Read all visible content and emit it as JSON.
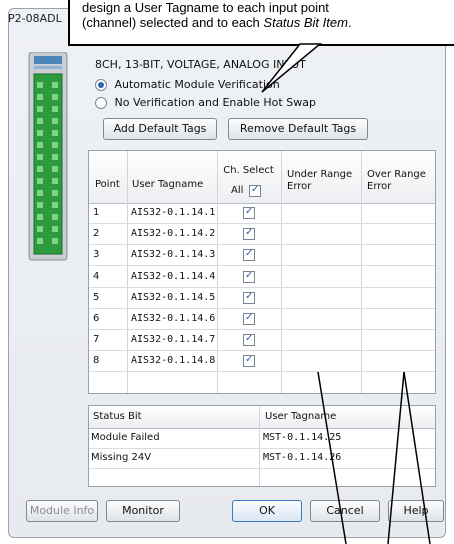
{
  "window": {
    "title": "P2-08ADL"
  },
  "callout": {
    "line1": "design a User Tagname to each input point",
    "line2_prefix": "(channel) selected and to each ",
    "line2_em": "Status Bit Item",
    "line2_suffix": "."
  },
  "module": {
    "description": "8CH, 13-BIT, VOLTAGE, ANALOG INPUT"
  },
  "options": {
    "auto_verify": "Automatic Module Verification",
    "no_verify": "No Verification and Enable Hot Swap",
    "selected": "auto_verify"
  },
  "buttons": {
    "add_default_tags": "Add Default Tags",
    "remove_default_tags": "Remove Default Tags",
    "module_info": "Module Info",
    "monitor": "Monitor",
    "ok": "OK",
    "cancel": "Cancel",
    "help": "Help"
  },
  "grid": {
    "headers": {
      "point": "Point",
      "user_tagname": "User Tagname",
      "ch_select": "Ch. Select",
      "all": "All",
      "under_range": "Under Range Error",
      "over_range": "Over Range Error"
    },
    "rows": [
      {
        "point": "1",
        "tag": "AIS32-0.1.14.1",
        "checked": true
      },
      {
        "point": "2",
        "tag": "AIS32-0.1.14.2",
        "checked": true
      },
      {
        "point": "3",
        "tag": "AIS32-0.1.14.3",
        "checked": true
      },
      {
        "point": "4",
        "tag": "AIS32-0.1.14.4",
        "checked": true
      },
      {
        "point": "5",
        "tag": "AIS32-0.1.14.5",
        "checked": true
      },
      {
        "point": "6",
        "tag": "AIS32-0.1.14.6",
        "checked": true
      },
      {
        "point": "7",
        "tag": "AIS32-0.1.14.7",
        "checked": true
      },
      {
        "point": "8",
        "tag": "AIS32-0.1.14.8",
        "checked": true
      }
    ]
  },
  "status": {
    "headers": {
      "status_bit": "Status Bit",
      "user_tagname": "User Tagname"
    },
    "rows": [
      {
        "bit": "Module Failed",
        "tag": "MST-0.1.14.25"
      },
      {
        "bit": "Missing 24V",
        "tag": "MST-0.1.14.26"
      }
    ]
  },
  "colors": {
    "accent": "#2f63b3",
    "check": "#2a59b4",
    "module_green": "#2e9a3e"
  }
}
